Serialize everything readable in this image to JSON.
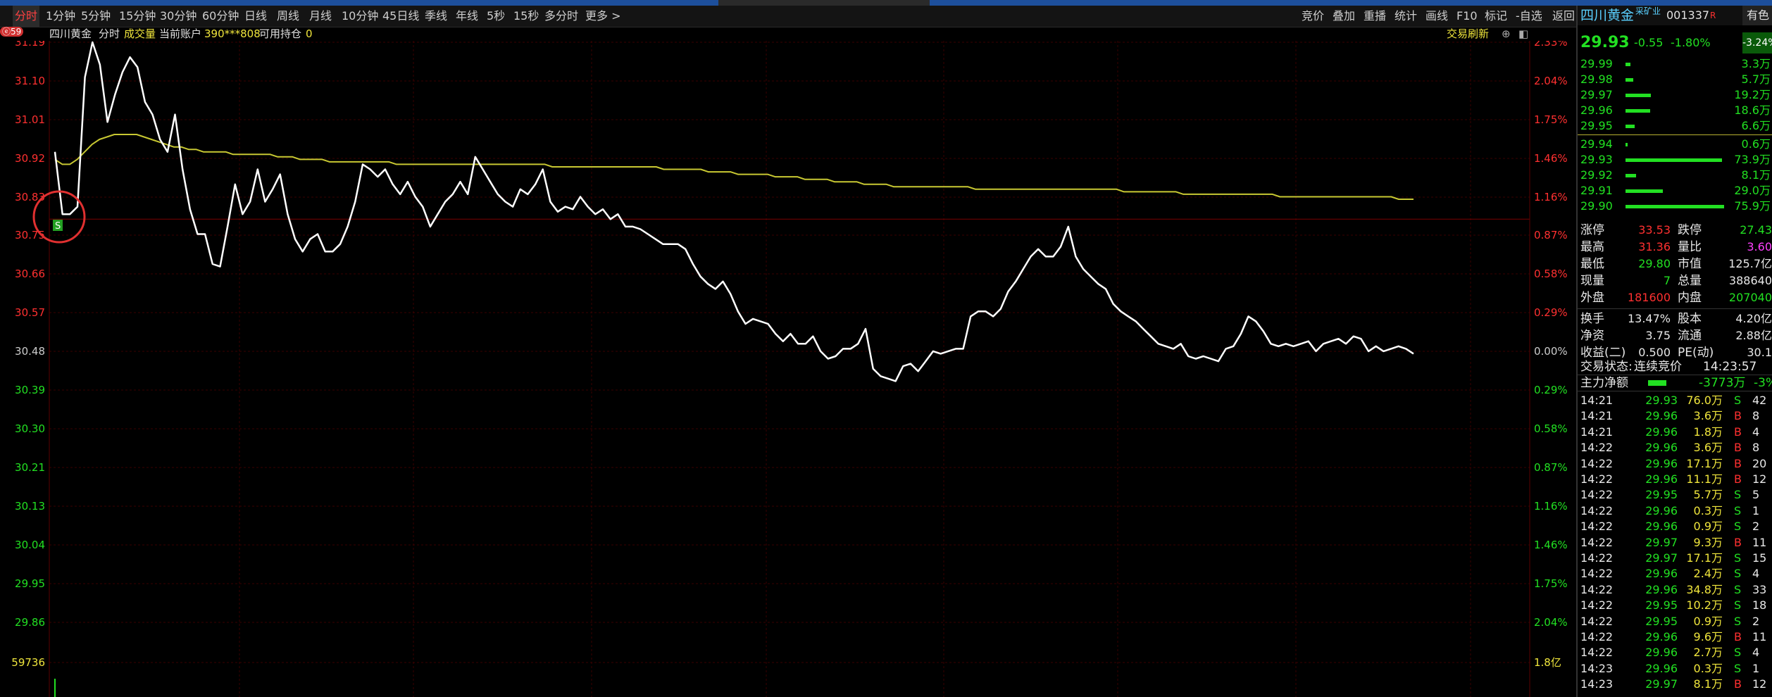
{
  "toolbar": {
    "left_items": [
      "分时",
      "1分钟",
      "5分钟",
      "15分钟",
      "30分钟",
      "60分钟",
      "日线",
      "周线",
      "月线",
      "10分钟",
      "45日线",
      "季线",
      "年线",
      "5秒",
      "15秒",
      "多分时",
      "更多 >"
    ],
    "active": "分时",
    "right_items": [
      "竞价",
      "叠加",
      "重播",
      "统计",
      "画线",
      "F10",
      "标记",
      "-自选",
      "返回"
    ]
  },
  "info_bar": {
    "stock_name": "四川黄金",
    "mode": "分时",
    "indicator": "成交量",
    "account_label": "当前账户",
    "account_no": "390***808",
    "position_label": "可用持仓",
    "position_value": "0",
    "refresh_label": "交易刷新",
    "badge": "ⓔ59"
  },
  "chart_data": {
    "type": "line",
    "y_price_ticks": [
      "31.19",
      "31.10",
      "31.01",
      "30.92",
      "30.83",
      "30.75",
      "30.66",
      "30.57",
      "30.48",
      "30.39",
      "30.30",
      "30.21",
      "30.13",
      "30.04",
      "29.95",
      "29.86"
    ],
    "y_pct_ticks": [
      "2.33%",
      "2.04%",
      "1.75%",
      "1.46%",
      "1.16%",
      "0.87%",
      "0.58%",
      "0.29%",
      "0.00%",
      "0.29%",
      "0.58%",
      "0.87%",
      "1.16%",
      "1.46%",
      "1.75%",
      "2.04%"
    ],
    "volume_left_label": "59736",
    "volume_right_label": "1.8亿",
    "ylim": [
      29.8,
      31.19
    ],
    "prev_close": 30.48,
    "x_count": 120,
    "colors": {
      "price": "#ffffff",
      "avg": "#c8c832",
      "up": "#ff3030",
      "down": "#22e022",
      "grid": "#3a0000"
    },
    "series": [
      {
        "values": [
          30.75,
          30.5,
          30.5,
          30.53,
          31.05,
          31.19,
          31.1,
          30.87,
          30.98,
          31.07,
          31.13,
          31.09,
          30.95,
          30.9,
          30.8,
          30.75,
          30.9,
          30.68,
          30.52,
          30.42,
          30.42,
          30.3,
          30.29,
          30.45,
          30.62,
          30.5,
          30.55,
          30.68,
          30.55,
          30.6,
          30.66,
          30.5,
          30.4,
          30.35,
          30.4,
          30.42,
          30.35,
          30.35,
          30.38,
          30.45,
          30.55,
          30.7,
          30.68,
          30.65,
          30.68,
          30.62,
          30.58,
          30.63,
          30.57,
          30.53,
          30.45,
          30.5,
          30.55,
          30.58,
          30.63,
          30.58,
          30.73,
          30.68,
          30.63,
          30.58,
          30.55,
          30.53,
          30.6,
          30.58,
          30.62,
          30.68,
          30.55,
          30.51,
          30.53,
          30.52,
          30.57,
          30.53,
          30.5,
          30.52,
          30.48,
          30.5,
          30.45,
          30.45,
          30.44,
          30.42,
          30.4,
          30.38,
          30.38,
          30.38,
          30.36,
          30.3,
          30.25,
          30.22,
          30.2,
          30.23,
          30.18,
          30.11,
          30.06,
          30.08,
          30.07,
          30.06,
          30.02,
          29.99,
          30.02,
          29.98,
          29.98,
          30.01,
          29.95,
          29.92,
          29.93,
          29.96,
          29.96,
          29.98,
          30.04,
          29.88,
          29.85,
          29.84,
          29.83,
          29.89,
          29.9,
          29.87,
          29.91,
          29.95,
          29.94,
          29.95,
          29.96,
          29.96,
          30.09,
          30.11,
          30.11,
          30.09,
          30.12,
          30.19,
          30.23,
          30.28,
          30.33,
          30.36,
          30.33,
          30.33,
          30.37,
          30.45,
          30.33,
          30.28,
          30.25,
          30.22,
          30.2,
          30.14,
          30.11,
          30.09,
          30.07,
          30.04,
          30.01,
          29.98,
          29.97,
          29.96,
          29.98,
          29.93,
          29.92,
          29.93,
          29.92,
          29.91,
          29.96,
          29.97,
          30.02,
          30.09,
          30.07,
          30.03,
          29.98,
          29.97,
          29.98,
          29.97,
          29.98,
          29.99,
          29.95,
          29.98,
          29.99,
          30.0,
          29.98,
          30.01,
          30.0,
          29.95,
          29.97,
          29.95,
          29.96,
          29.97,
          29.96,
          29.94
        ]
      },
      {
        "values": [
          30.72,
          30.7,
          30.7,
          30.72,
          30.75,
          30.78,
          30.8,
          30.81,
          30.82,
          30.82,
          30.82,
          30.82,
          30.81,
          30.8,
          30.79,
          30.78,
          30.77,
          30.77,
          30.76,
          30.76,
          30.75,
          30.75,
          30.75,
          30.75,
          30.74,
          30.74,
          30.74,
          30.74,
          30.74,
          30.74,
          30.73,
          30.73,
          30.73,
          30.72,
          30.72,
          30.72,
          30.72,
          30.71,
          30.71,
          30.71,
          30.71,
          30.71,
          30.71,
          30.71,
          30.71,
          30.71,
          30.7,
          30.7,
          30.7,
          30.7,
          30.7,
          30.7,
          30.7,
          30.7,
          30.7,
          30.7,
          30.7,
          30.7,
          30.7,
          30.7,
          30.7,
          30.7,
          30.7,
          30.7,
          30.7,
          30.7,
          30.7,
          30.69,
          30.69,
          30.69,
          30.69,
          30.69,
          30.69,
          30.69,
          30.69,
          30.69,
          30.69,
          30.69,
          30.69,
          30.69,
          30.69,
          30.69,
          30.68,
          30.68,
          30.68,
          30.68,
          30.68,
          30.68,
          30.67,
          30.67,
          30.67,
          30.67,
          30.66,
          30.66,
          30.66,
          30.66,
          30.66,
          30.65,
          30.65,
          30.65,
          30.65,
          30.64,
          30.64,
          30.64,
          30.64,
          30.63,
          30.63,
          30.63,
          30.63,
          30.62,
          30.62,
          30.62,
          30.62,
          30.61,
          30.61,
          30.61,
          30.61,
          30.61,
          30.61,
          30.61,
          30.61,
          30.61,
          30.61,
          30.61,
          30.6,
          30.6,
          30.6,
          30.6,
          30.6,
          30.6,
          30.6,
          30.6,
          30.6,
          30.6,
          30.6,
          30.6,
          30.6,
          30.6,
          30.6,
          30.6,
          30.6,
          30.6,
          30.6,
          30.6,
          30.59,
          30.59,
          30.59,
          30.59,
          30.59,
          30.59,
          30.59,
          30.59,
          30.58,
          30.58,
          30.58,
          30.58,
          30.58,
          30.58,
          30.58,
          30.58,
          30.58,
          30.58,
          30.58,
          30.58,
          30.58,
          30.57,
          30.57,
          30.57,
          30.57,
          30.57,
          30.57,
          30.57,
          30.57,
          30.57,
          30.57,
          30.57,
          30.57,
          30.57,
          30.57,
          30.57,
          30.57,
          30.56,
          30.56,
          30.56
        ]
      }
    ]
  },
  "panel": {
    "name": "四川黄金",
    "tag": "采矿业",
    "code": "001337",
    "r_mark": "R",
    "tab_label": "有色",
    "price": "29.93",
    "change": "-0.55",
    "change_pct": "-1.80%",
    "sector_pct": "-3.24%",
    "asks": [
      {
        "price": "29.99",
        "vol": "3.3万",
        "bar": 0.05
      },
      {
        "price": "29.98",
        "vol": "5.7万",
        "bar": 0.08
      },
      {
        "price": "29.97",
        "vol": "19.2万",
        "bar": 0.26
      },
      {
        "price": "29.96",
        "vol": "18.6万",
        "bar": 0.25
      },
      {
        "price": "29.95",
        "vol": "6.6万",
        "bar": 0.09
      }
    ],
    "bids": [
      {
        "price": "29.94",
        "vol": "0.6万",
        "bar": 0.02
      },
      {
        "price": "29.93",
        "vol": "73.9万",
        "bar": 0.98
      },
      {
        "price": "29.92",
        "vol": "8.1万",
        "bar": 0.11
      },
      {
        "price": "29.91",
        "vol": "29.0万",
        "bar": 0.38
      },
      {
        "price": "29.90",
        "vol": "75.9万",
        "bar": 1.0
      }
    ],
    "stats": [
      [
        "涨停",
        "33.53",
        "跌停",
        "27.43"
      ],
      [
        "最高",
        "31.36",
        "量比",
        "3.60"
      ],
      [
        "最低",
        "29.80",
        "市值",
        "125.7亿"
      ],
      [
        "现量",
        "7",
        "总量",
        "388640"
      ],
      [
        "外盘",
        "181600",
        "内盘",
        "207040"
      ],
      [
        "换手",
        "13.47%",
        "股本",
        "4.20亿"
      ],
      [
        "净资",
        "3.75",
        "流通",
        "2.88亿"
      ],
      [
        "收益(二)",
        "0.500",
        "PE(动)",
        "30.1"
      ]
    ],
    "status_label": "交易状态:",
    "status_value": "连续竞价",
    "status_time": "14:23:57",
    "flow_label": "主力净额",
    "flow_value": "-3773万",
    "flow_pct": "-3%",
    "ticks": [
      {
        "time": "14:21",
        "price": "29.93",
        "vol": "76.0万",
        "side": "S",
        "n": "42"
      },
      {
        "time": "14:21",
        "price": "29.96",
        "vol": "3.6万",
        "side": "B",
        "n": "8"
      },
      {
        "time": "14:21",
        "price": "29.96",
        "vol": "1.8万",
        "side": "B",
        "n": "4"
      },
      {
        "time": "14:22",
        "price": "29.96",
        "vol": "3.6万",
        "side": "B",
        "n": "8"
      },
      {
        "time": "14:22",
        "price": "29.96",
        "vol": "17.1万",
        "side": "B",
        "n": "20"
      },
      {
        "time": "14:22",
        "price": "29.96",
        "vol": "11.1万",
        "side": "B",
        "n": "12"
      },
      {
        "time": "14:22",
        "price": "29.95",
        "vol": "5.7万",
        "side": "S",
        "n": "5"
      },
      {
        "time": "14:22",
        "price": "29.96",
        "vol": "0.3万",
        "side": "S",
        "n": "1"
      },
      {
        "time": "14:22",
        "price": "29.96",
        "vol": "0.9万",
        "side": "S",
        "n": "2"
      },
      {
        "time": "14:22",
        "price": "29.97",
        "vol": "9.3万",
        "side": "B",
        "n": "11"
      },
      {
        "time": "14:22",
        "price": "29.97",
        "vol": "17.1万",
        "side": "S",
        "n": "15"
      },
      {
        "time": "14:22",
        "price": "29.96",
        "vol": "2.4万",
        "side": "S",
        "n": "4"
      },
      {
        "time": "14:22",
        "price": "29.96",
        "vol": "34.8万",
        "side": "S",
        "n": "33"
      },
      {
        "time": "14:22",
        "price": "29.95",
        "vol": "10.2万",
        "side": "S",
        "n": "18"
      },
      {
        "time": "14:22",
        "price": "29.95",
        "vol": "0.9万",
        "side": "S",
        "n": "2"
      },
      {
        "time": "14:22",
        "price": "29.96",
        "vol": "9.6万",
        "side": "B",
        "n": "11"
      },
      {
        "time": "14:22",
        "price": "29.96",
        "vol": "2.7万",
        "side": "S",
        "n": "4"
      },
      {
        "time": "14:23",
        "price": "29.96",
        "vol": "0.3万",
        "side": "S",
        "n": "1"
      },
      {
        "time": "14:23",
        "price": "29.97",
        "vol": "8.1万",
        "side": "B",
        "n": "12"
      }
    ]
  }
}
